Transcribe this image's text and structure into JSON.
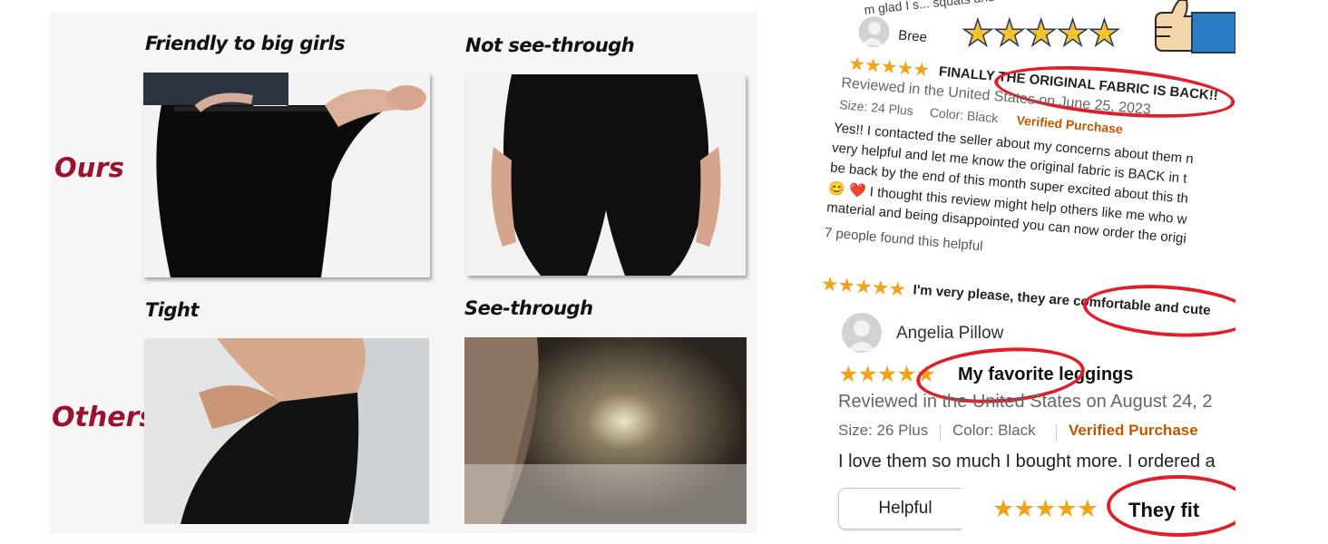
{
  "comparison": {
    "row_ours": "Ours",
    "row_others": "Others",
    "captions": {
      "friendly": "Friendly to big girls",
      "not_see_through": "Not see-through",
      "tight": "Tight",
      "see_through": "See-through"
    }
  },
  "reviews": {
    "top_snippet": "m glad I s... squats and these are",
    "review1": {
      "author": "Bree",
      "stars": "★★★★★",
      "title": "FINALLY THE ORIGINAL FABRIC IS BACK!!",
      "meta": "Reviewed in the United States on June 25, 2023",
      "size": "Size: 24 Plus",
      "color": "Color: Black",
      "verified": "Verified Purchase",
      "body": [
        "Yes!! I contacted the seller about my concerns about them n",
        "very helpful and let me know the original fabric is BACK in t",
        "be back by the end of this month super excited about this th",
        "😊 ❤️ I thought this review might help others like me who w",
        "material and being disappointed you can now order the origi"
      ],
      "helpful_count": "7 people found this helpful"
    },
    "review2": {
      "stars": "★★★★★",
      "title": "I'm very please, they are comfortable and cute"
    },
    "review3": {
      "author": "Angelia Pillow",
      "stars": "★★★★★",
      "title": "My favorite leggings",
      "meta": "Reviewed in the United States on August 24, 2",
      "size": "Size: 26 Plus",
      "color": "Color: Black",
      "verified": "Verified Purchase",
      "body": "I love them so much I bought more. I ordered a",
      "helpful_button": "Helpful"
    },
    "review4": {
      "stars": "★★★★★",
      "title": "They fit"
    },
    "badge_stars": "★★★★★"
  }
}
